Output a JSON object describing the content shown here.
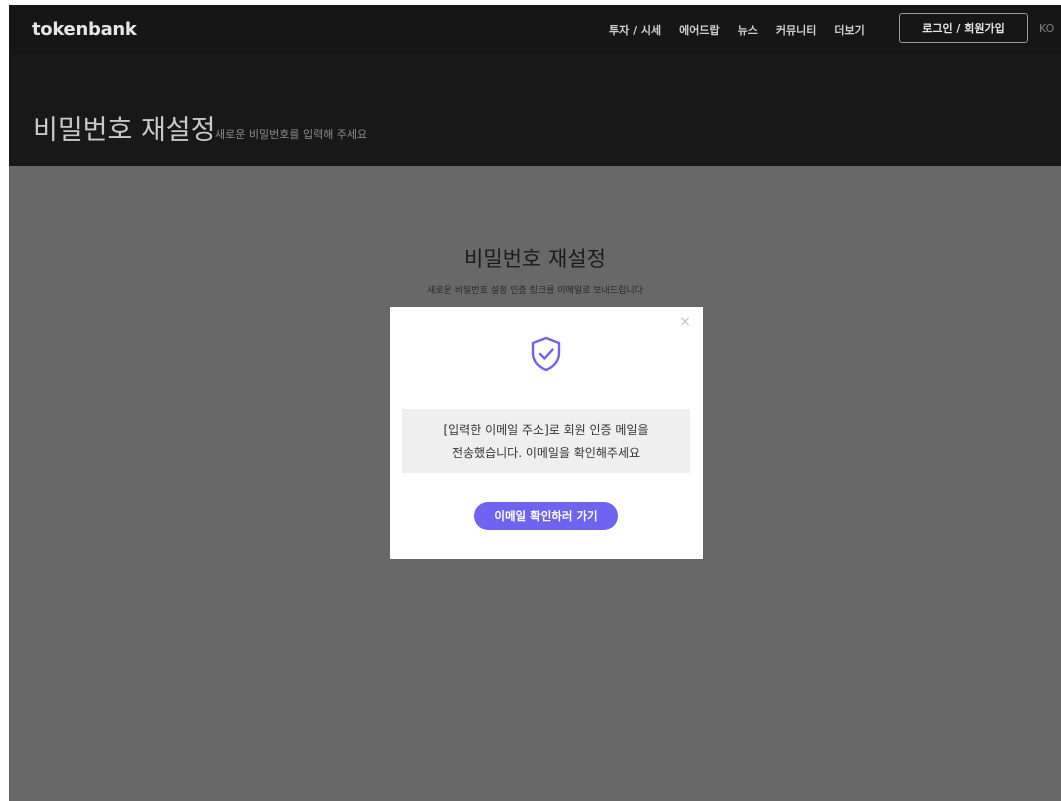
{
  "header": {
    "logo": "tokenbank",
    "nav": [
      "투자 / 시세",
      "에어드랍",
      "뉴스",
      "커뮤니티",
      "더보기"
    ],
    "login_label": "로그인 / 회원가입",
    "lang": "KO"
  },
  "hero": {
    "title": "비밀번호 재설정",
    "subtitle": "새로운 비밀번호를 입력해 주세요"
  },
  "content": {
    "title": "비밀번호 재설정",
    "subtitle": "새로운 비밀번호 설정 인증 링크를 이메일로 보내드립니다"
  },
  "modal": {
    "close_icon": "×",
    "icon": "shield-check-icon",
    "message_line1": "[입력한 이메일 주소]로 회원 인증 메일을",
    "message_line2": "전송했습니다. 이메일을 확인해주세요",
    "button_label": "이메일 확인하러 가기"
  },
  "colors": {
    "accent": "#6f63f1",
    "header_bg": "#161616",
    "overlay": "#686868"
  }
}
